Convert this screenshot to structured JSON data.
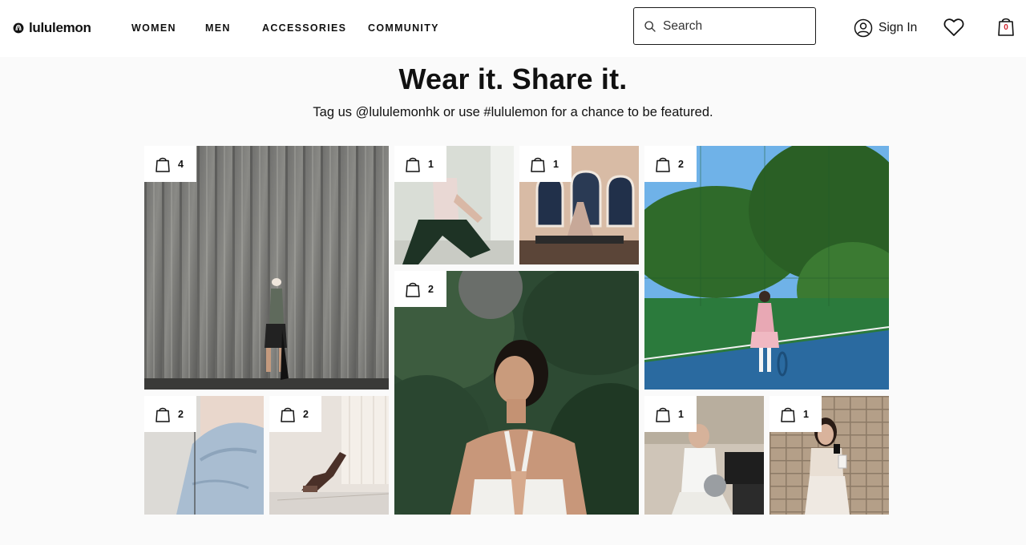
{
  "brand": {
    "logo_text": "lululemon"
  },
  "nav": {
    "items": [
      "WOMEN",
      "MEN",
      "ACCESSORIES",
      "COMMUNITY"
    ]
  },
  "search": {
    "placeholder": "Search",
    "value": ""
  },
  "account": {
    "sign_in_label": "Sign In"
  },
  "bag": {
    "count": "0"
  },
  "hero": {
    "title": "Wear it. Share it.",
    "subtitle": "Tag us @lululemonhk or use #lululemon for a chance to be featured."
  },
  "gallery": {
    "tiles": [
      {
        "product_count": "4",
        "scene": "woman-against-metal-wall"
      },
      {
        "product_count": "1",
        "scene": "lunge-green-pants"
      },
      {
        "product_count": "1",
        "scene": "pilates-reformer-arched-windows"
      },
      {
        "product_count": "2",
        "scene": "tennis-court-pink-dress"
      },
      {
        "product_count": "2",
        "scene": "meditation-forest-backdrop"
      },
      {
        "product_count": "2",
        "scene": "light-blue-pants-closeup"
      },
      {
        "product_count": "2",
        "scene": "yoga-arm-balance-window"
      },
      {
        "product_count": "1",
        "scene": "white-outfit-reformer-ball"
      },
      {
        "product_count": "1",
        "scene": "mirror-selfie-coffee"
      }
    ]
  },
  "colors": {
    "header_bg": "#ffffff",
    "page_bg": "#fafafa",
    "text": "#111111",
    "bag_count": "#d22630"
  }
}
